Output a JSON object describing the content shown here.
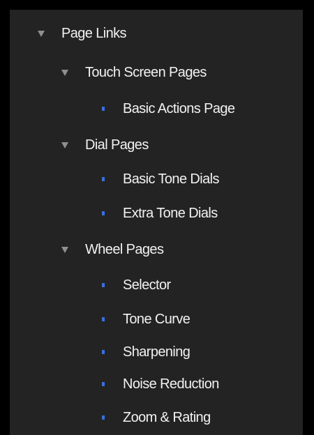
{
  "colors": {
    "background": "#000000",
    "panel": "#232323",
    "text": "#f2f2f2",
    "caret": "#8f8f8f",
    "bullet": "#3a6fe0"
  },
  "tree": {
    "root": {
      "label": "Page Links",
      "icon": "triangle-down-icon",
      "groups": [
        {
          "label": "Touch Screen Pages",
          "icon": "triangle-down-icon",
          "items": [
            "Basic Actions Page"
          ]
        },
        {
          "label": "Dial Pages",
          "icon": "triangle-down-icon",
          "items": [
            "Basic Tone Dials",
            "Extra Tone Dials"
          ]
        },
        {
          "label": "Wheel Pages",
          "icon": "triangle-down-icon",
          "items": [
            "Selector",
            "Tone Curve",
            "Sharpening",
            "Noise Reduction",
            "Zoom & Rating"
          ]
        }
      ]
    }
  }
}
